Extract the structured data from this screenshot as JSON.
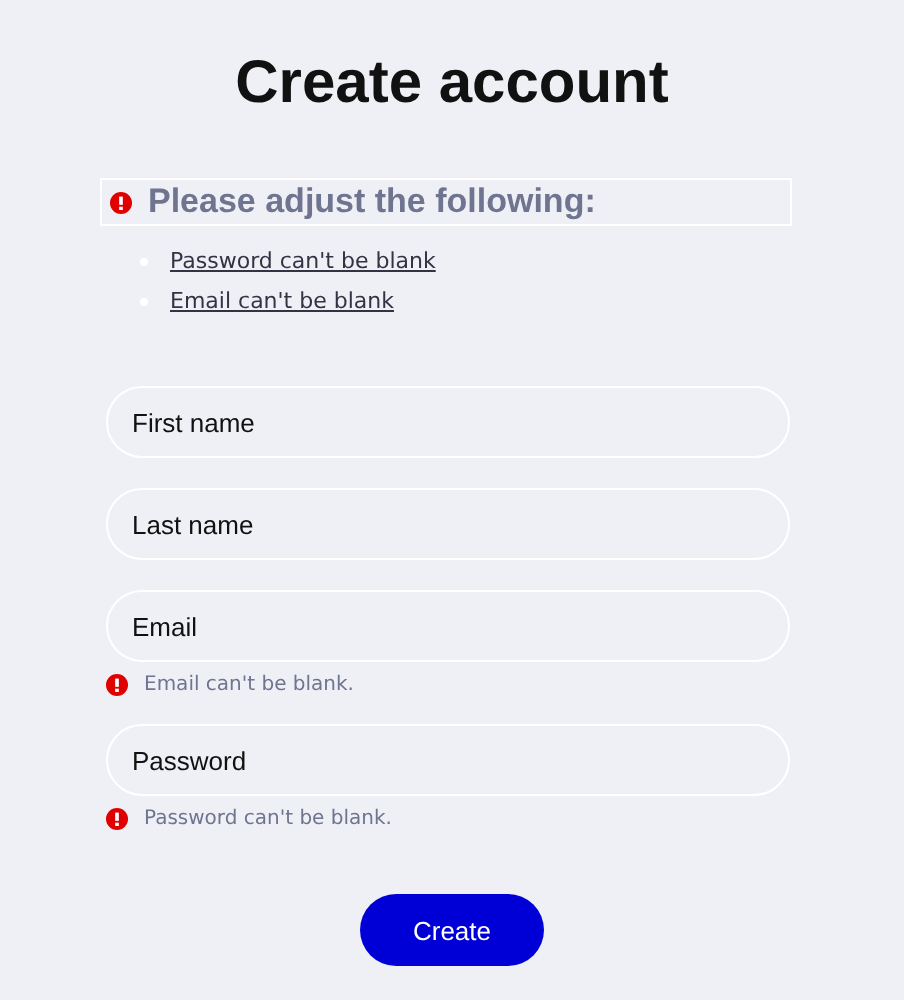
{
  "title": "Create account",
  "error_summary": {
    "heading": "Please adjust the following:",
    "items": [
      "Password can't be blank",
      "Email can't be blank"
    ]
  },
  "fields": [
    {
      "placeholder": "First name"
    },
    {
      "placeholder": "Last name"
    },
    {
      "placeholder": "Email",
      "error": "Email can't be blank."
    },
    {
      "placeholder": "Password",
      "error": "Password can't be blank."
    }
  ],
  "submit": "Create"
}
